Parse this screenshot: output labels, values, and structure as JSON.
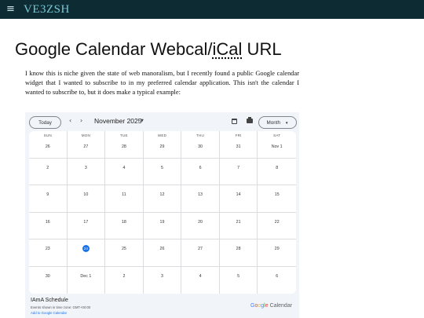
{
  "topbar": {
    "menu_icon": "≡",
    "site_title": "VE3ZSH"
  },
  "article": {
    "title_start": "Google Calendar Webcal/",
    "title_abbr": "iCal",
    "title_end": " URL",
    "intro": "I know this is niche given the state of web manoralism, but I recently found a public Google calendar widget that I wanted to subscribe to in my preferred calendar application. This isn't the calendar I wanted to subscribe to, but it does make a typical example:"
  },
  "calendar": {
    "today_label": "Today",
    "prev_icon": "‹",
    "next_icon": "›",
    "month_label": "November 2025",
    "month_caret": "▼",
    "view_label": "Month",
    "view_caret": "▼",
    "weekdays": [
      "SUN",
      "MON",
      "TUE",
      "WED",
      "THU",
      "FRI",
      "SAT"
    ],
    "weeks": [
      [
        "26",
        "27",
        "28",
        "29",
        "30",
        "31",
        "Nov 1"
      ],
      [
        "2",
        "3",
        "4",
        "5",
        "6",
        "7",
        "8"
      ],
      [
        "9",
        "10",
        "11",
        "12",
        "13",
        "14",
        "15"
      ],
      [
        "16",
        "17",
        "18",
        "19",
        "20",
        "21",
        "22"
      ],
      [
        "23",
        "24",
        "25",
        "26",
        "27",
        "28",
        "29"
      ],
      [
        "30",
        "Dec 1",
        "2",
        "3",
        "4",
        "5",
        "6"
      ]
    ],
    "today_date": "24",
    "calendar_name": "IAmA Schedule",
    "timezone_note": "Events shown in time zone: GMT+00:00",
    "add_link": "Add to Google Calendar",
    "brand_letters": [
      "G",
      "o",
      "o",
      "g",
      "l",
      "e"
    ],
    "brand_suffix": "Calendar",
    "brand_colors": [
      "#4285f4",
      "#ea4335",
      "#fbbc05",
      "#4285f4",
      "#34a853",
      "#ea4335"
    ],
    "today_color": "#1a73e8",
    "icons": {
      "calendar": "calendar-icon",
      "print": "print-icon"
    }
  }
}
